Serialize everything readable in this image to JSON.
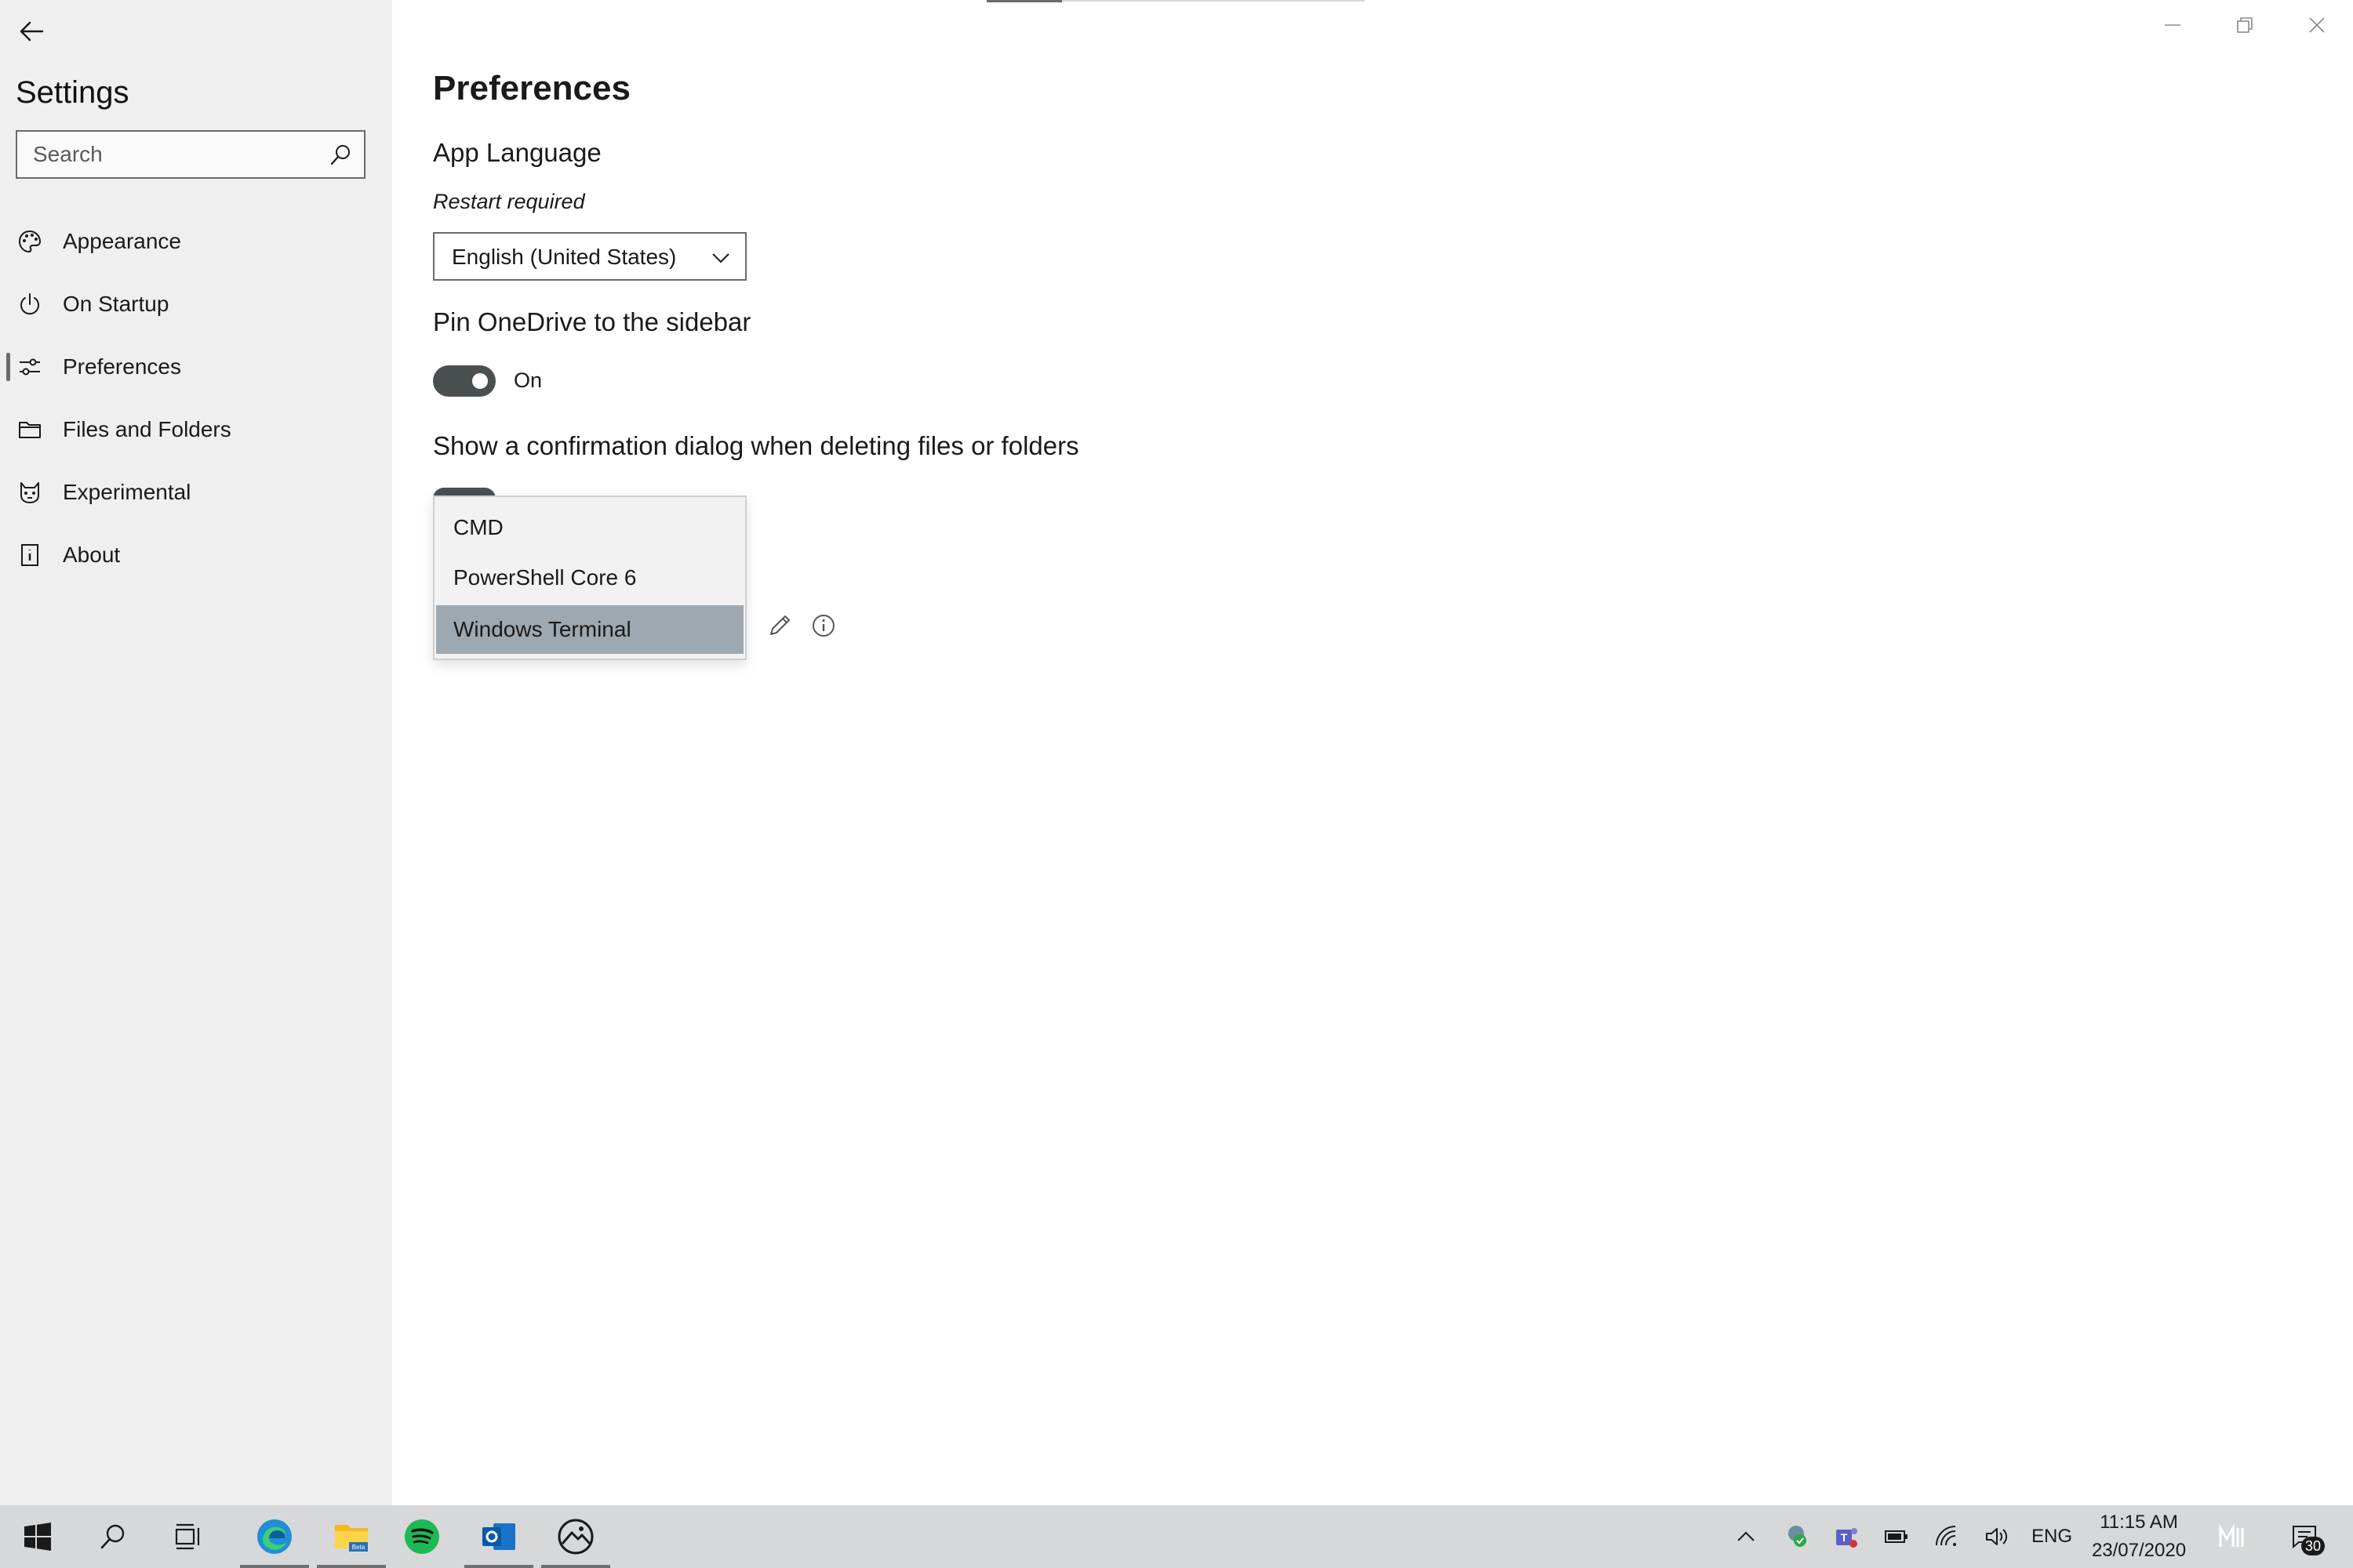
{
  "sidebar": {
    "app_title": "Settings",
    "search_placeholder": "Search",
    "items": [
      {
        "label": "Appearance",
        "icon": "palette-icon"
      },
      {
        "label": "On Startup",
        "icon": "power-icon"
      },
      {
        "label": "Preferences",
        "icon": "sliders-icon",
        "selected": true
      },
      {
        "label": "Files and Folders",
        "icon": "folder-icon"
      },
      {
        "label": "Experimental",
        "icon": "cat-icon"
      },
      {
        "label": "About",
        "icon": "info-book-icon"
      }
    ]
  },
  "main": {
    "page_title": "Preferences",
    "app_language": {
      "heading": "App Language",
      "note": "Restart required",
      "selected_value": "English (United States)"
    },
    "onedrive": {
      "heading": "Pin OneDrive to the sidebar",
      "toggle_state": "On",
      "enabled": true
    },
    "confirm_delete": {
      "heading": "Show a confirmation dialog when deleting files or folders"
    },
    "terminal_dropdown": {
      "options": [
        "CMD",
        "PowerShell Core 6",
        "Windows Terminal"
      ],
      "selected": "Windows Terminal"
    }
  },
  "taskbar": {
    "apps": [
      "start-icon",
      "search-icon",
      "task-view-icon",
      "edge-icon",
      "file-explorer-beta-icon",
      "spotify-icon",
      "outlook-icon",
      "files-app-icon"
    ],
    "active_app": "files-app-icon",
    "tray": {
      "language": "ENG",
      "time": "11:15 AM",
      "date": "23/07/2020",
      "notification_count": "30"
    }
  },
  "colors": {
    "sidebar_bg": "#efefef",
    "toggle_on": "#4a5052",
    "selected_option": "#9ea8b0",
    "taskbar_bg": "#d6d8da"
  }
}
